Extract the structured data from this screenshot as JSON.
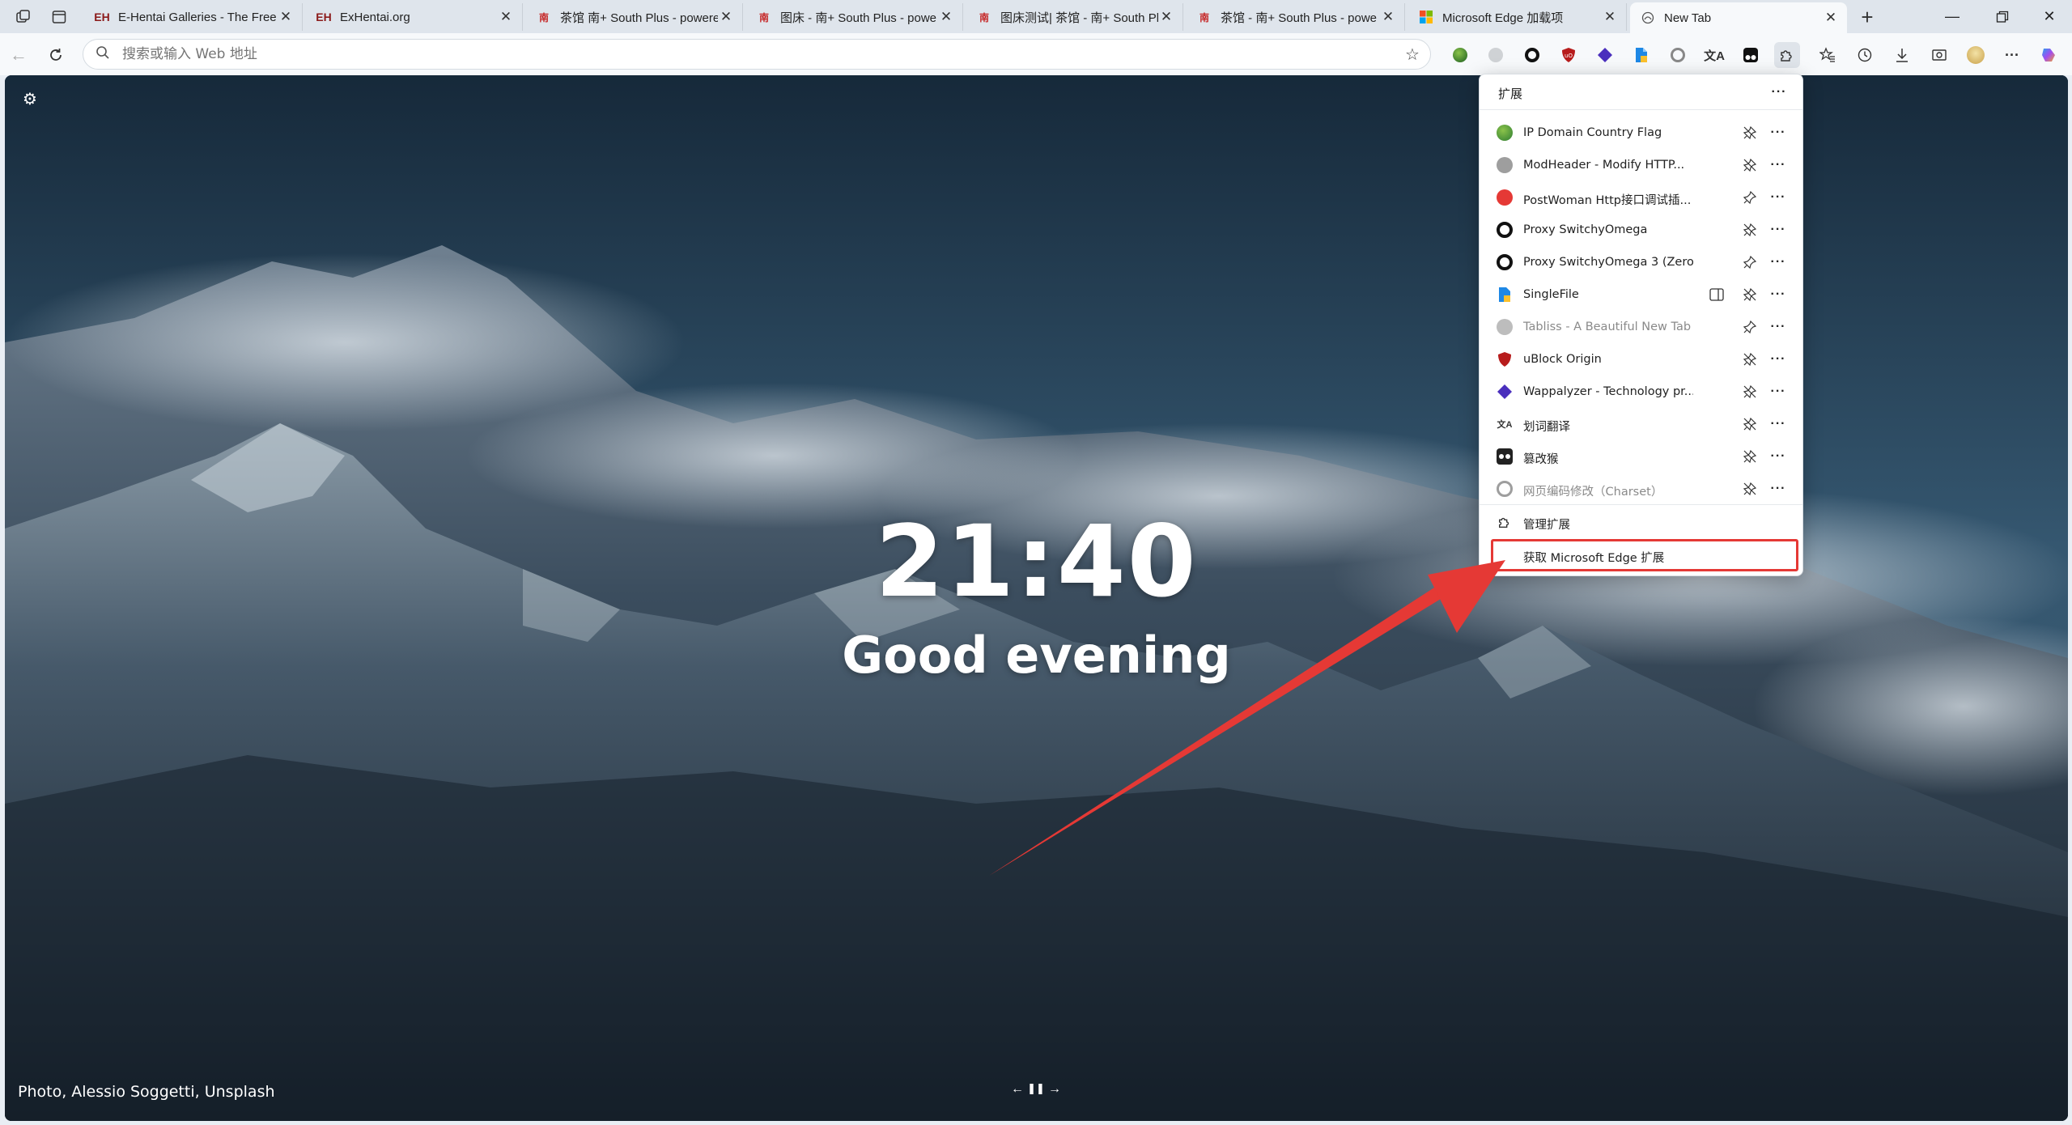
{
  "tabs": [
    {
      "title": "E-Hentai Galleries - The Free H",
      "favicon": "EH",
      "color": "#8b1a1a"
    },
    {
      "title": "ExHentai.org",
      "favicon": "EH",
      "color": "#8b1a1a"
    },
    {
      "title": "茶馆 南+ South Plus - powere",
      "favicon": "南",
      "color": "#c62828"
    },
    {
      "title": "图床 - 南+ South Plus - powe",
      "favicon": "南",
      "color": "#c62828"
    },
    {
      "title": "图床测试| 茶馆 - 南+ South Pl",
      "favicon": "南",
      "color": "#c62828"
    },
    {
      "title": "茶馆 - 南+ South Plus - powe",
      "favicon": "南",
      "color": "#c62828"
    },
    {
      "title": "Microsoft Edge 加载项",
      "favicon": "ms",
      "color": "#0078d4"
    },
    {
      "title": "New Tab",
      "favicon": "tabliss",
      "color": "#555"
    }
  ],
  "toolbar": {
    "address_placeholder": "搜索或输入 Web 地址"
  },
  "newtab": {
    "time": "21:40",
    "greeting": "Good evening",
    "photo_credit": "Photo, Alessio Soggetti, Unsplash"
  },
  "extensions_panel": {
    "title": "扩展",
    "items": [
      {
        "name": "IP Domain Country Flag",
        "icon_color": "#2e7d32",
        "pinned": true,
        "disabled": false
      },
      {
        "name": "ModHeader - Modify HTTP...",
        "icon_color": "#9e9e9e",
        "pinned": true,
        "disabled": false
      },
      {
        "name": "PostWoman Http接口调试插...",
        "icon_color": "#e53935",
        "pinned": false,
        "disabled": false
      },
      {
        "name": "Proxy SwitchyOmega",
        "icon_color": "#111111",
        "pinned": true,
        "disabled": false
      },
      {
        "name": "Proxy SwitchyOmega 3 (Zero...",
        "icon_color": "#111111",
        "pinned": false,
        "disabled": false
      },
      {
        "name": "SingleFile",
        "icon_color": "#1e88e5",
        "pinned": true,
        "disabled": false
      },
      {
        "name": "Tabliss - A Beautiful New Tab",
        "icon_color": "#bdbdbd",
        "pinned": false,
        "disabled": true
      },
      {
        "name": "uBlock Origin",
        "icon_color": "#b71c1c",
        "pinned": true,
        "disabled": false
      },
      {
        "name": "Wappalyzer - Technology pr...",
        "icon_color": "#4a2fbd",
        "pinned": true,
        "disabled": false
      },
      {
        "name": "划词翻译",
        "icon_color": "#333333",
        "pinned": true,
        "disabled": false
      },
      {
        "name": "篡改猴",
        "icon_color": "#222222",
        "pinned": true,
        "disabled": false
      },
      {
        "name": "网页编码修改（Charset）",
        "icon_color": "#9e9e9e",
        "pinned": true,
        "disabled": true
      }
    ],
    "manage_label": "管理扩展",
    "get_label": "获取 Microsoft Edge 扩展"
  },
  "colors": {
    "highlight": "#e53935",
    "arrow": "#e53935"
  }
}
